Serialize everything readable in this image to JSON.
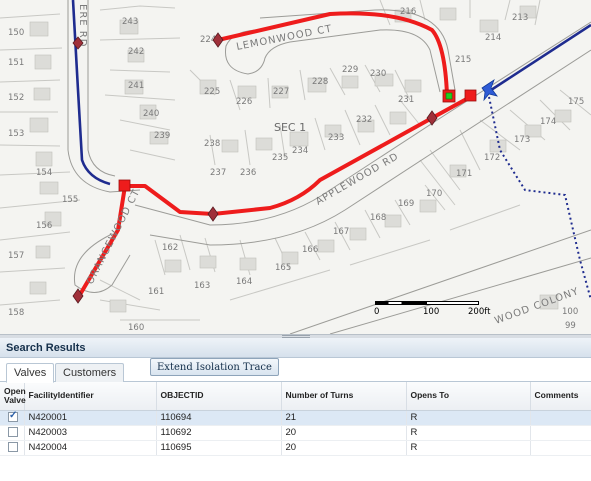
{
  "map": {
    "parcels": [
      "216",
      "213",
      "214",
      "215",
      "224",
      "243",
      "150",
      "242",
      "151",
      "241",
      "225",
      "226",
      "227",
      "228",
      "229",
      "230",
      "231",
      "152",
      "240",
      "175",
      "232",
      "174",
      "173",
      "172",
      "239",
      "238",
      "235",
      "234",
      "233",
      "153",
      "237",
      "236",
      "171",
      "154",
      "170",
      "155",
      "169",
      "168",
      "167",
      "156",
      "162",
      "166",
      "157",
      "165",
      "163",
      "164",
      "161",
      "158",
      "160",
      "100",
      "99"
    ],
    "streets": {
      "lemonwood": "LEMONWOOD CT",
      "applewood": "APPLEWOOD RD",
      "orangewood": "ORANGEWOOD CT",
      "left_road": "ERE RD",
      "colony": "WOOD COLONY"
    },
    "section_label": "SEC 1",
    "scale": {
      "zero": "0",
      "mid": "100",
      "end": "200ft"
    },
    "colors": {
      "trace": "#ee1c1c",
      "main": "#1f2c8f",
      "valve": "#a0303a",
      "selected_valve": "#22cc22"
    }
  },
  "panel": {
    "title": "Search Results",
    "tabs": [
      "Valves",
      "Customers"
    ],
    "active_tab": "Valves",
    "extend_button": "Extend Isolation Trace",
    "columns": [
      "Open Valve",
      "FacilityIdentifier",
      "OBJECTID",
      "Number of Turns",
      "Opens To",
      "Comments"
    ],
    "rows": [
      {
        "checked": true,
        "facility": "N420001",
        "objectid": "110694",
        "turns": "21",
        "opens_to": "R",
        "comments": ""
      },
      {
        "checked": false,
        "facility": "N420003",
        "objectid": "110692",
        "turns": "20",
        "opens_to": "R",
        "comments": ""
      },
      {
        "checked": false,
        "facility": "N420004",
        "objectid": "110695",
        "turns": "20",
        "opens_to": "R",
        "comments": ""
      }
    ]
  }
}
